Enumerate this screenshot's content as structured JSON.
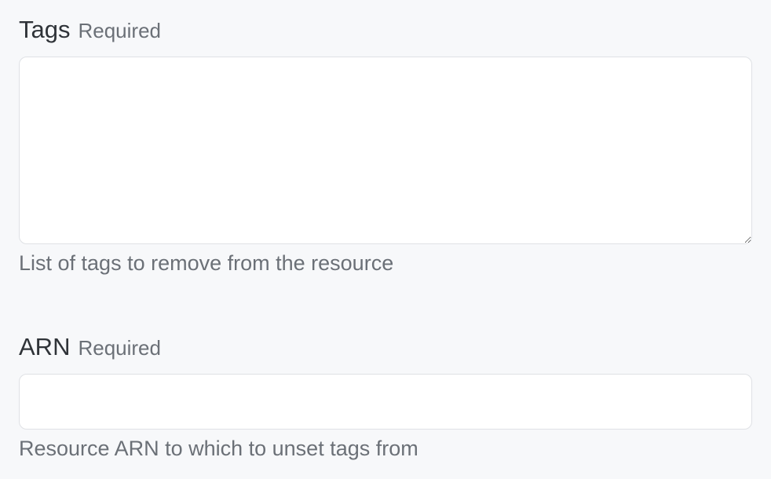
{
  "fields": {
    "tags": {
      "label": "Tags",
      "required_text": "Required",
      "value": "",
      "placeholder": "",
      "help": "List of tags to remove from the resource"
    },
    "arn": {
      "label": "ARN",
      "required_text": "Required",
      "value": "",
      "placeholder": "",
      "help": "Resource ARN to which to unset tags from"
    }
  },
  "icons": {
    "resize_handle": "resize-grip-icon"
  },
  "colors": {
    "background": "#f7f8fa",
    "label": "#2f3338",
    "muted": "#6b7077",
    "border": "#dfe1e5",
    "input_bg": "#ffffff"
  }
}
